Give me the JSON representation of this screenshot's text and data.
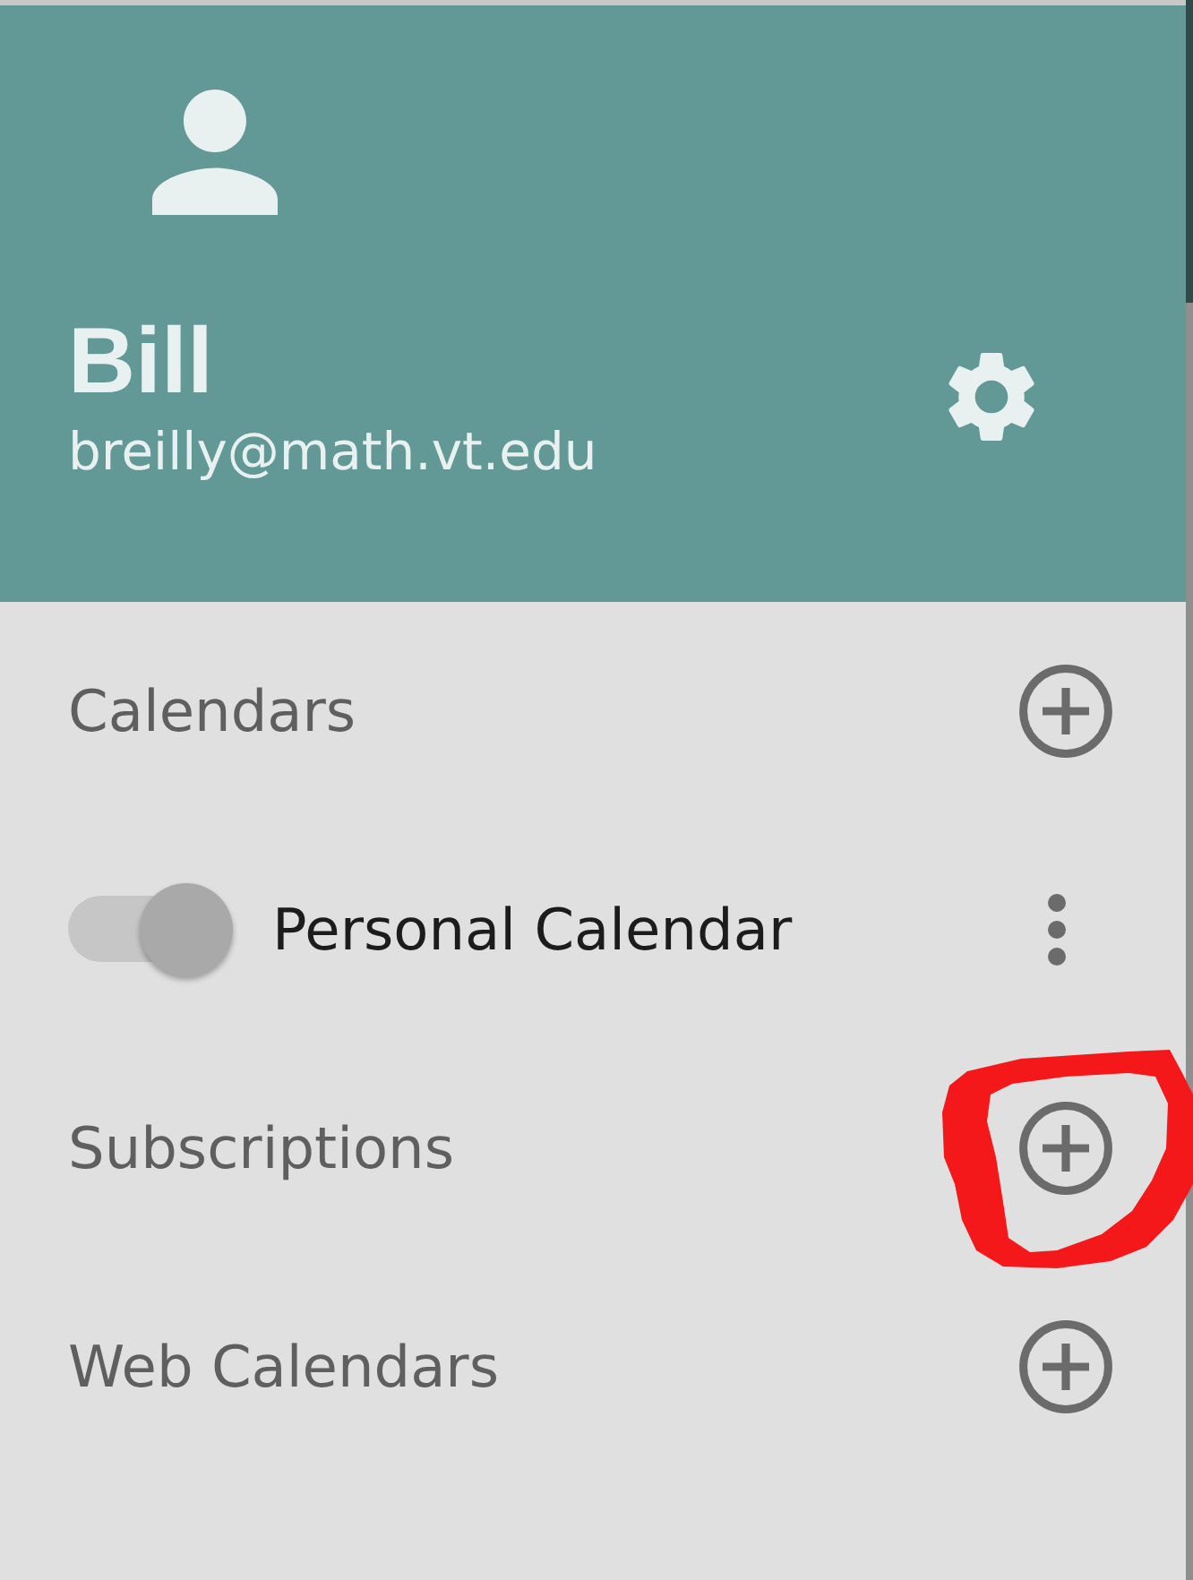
{
  "header": {
    "name": "Bill",
    "email": "breilly@math.vt.edu"
  },
  "list": [
    {
      "kind": "section",
      "label": "Calendars",
      "circled": false
    },
    {
      "kind": "calendar",
      "label": "Personal Calendar",
      "on": true
    },
    {
      "kind": "section",
      "label": "Subscriptions",
      "circled": true
    },
    {
      "kind": "section",
      "label": "Web Calendars",
      "circled": false
    }
  ]
}
